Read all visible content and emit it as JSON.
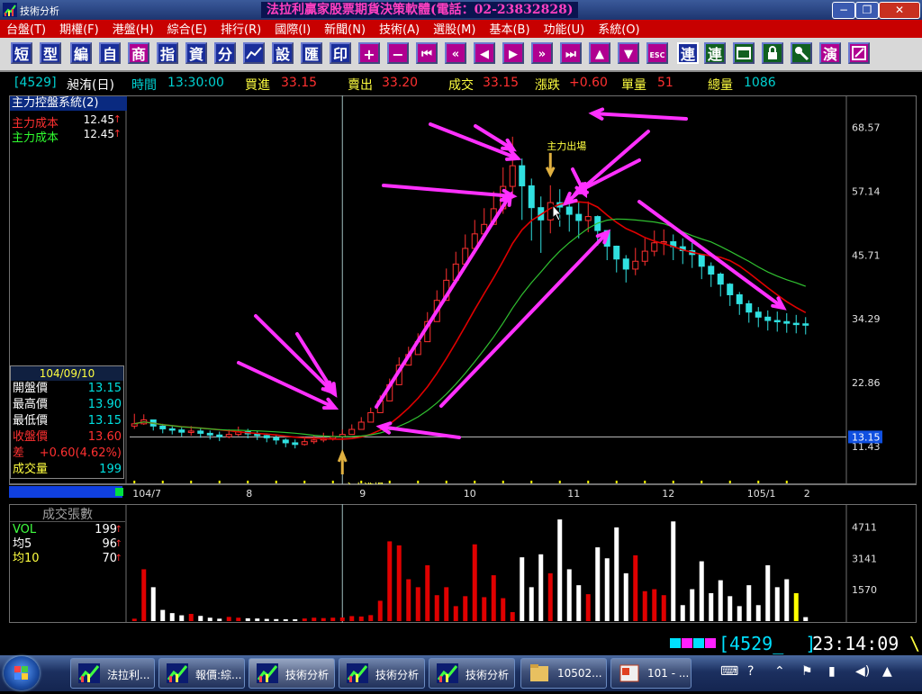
{
  "window": {
    "app_title": "技術分析",
    "headline": "法拉利贏家股票期貨決策軟體(電話：02-23832828)",
    "minimize_label": "−",
    "restore_label": "❐",
    "close_label": "✕"
  },
  "menu": [
    "台盤(T)",
    "期權(F)",
    "港盤(H)",
    "綜合(E)",
    "排行(R)",
    "國際(I)",
    "新聞(N)",
    "技術(A)",
    "選股(M)",
    "基本(B)",
    "功能(U)",
    "系統(O)"
  ],
  "toolbar": {
    "text_buttons": [
      "短",
      "型",
      "編",
      "自",
      "商",
      "指",
      "資",
      "分"
    ],
    "chart_icon": "chart-icon",
    "text_buttons2": [
      "設",
      "匯",
      "印"
    ],
    "plus": "+",
    "minus": "−",
    "nav_icons": [
      "rewind-bar-icon",
      "fast-rewind-icon",
      "prev-icon",
      "next-icon",
      "fast-forward-icon",
      "forward-bar-icon",
      "up-icon",
      "down-icon"
    ],
    "esc_label": "ESC",
    "lian1": "連",
    "lian2": "連",
    "tail_icons": [
      "window-icon",
      "lock-icon",
      "tools-icon",
      "演"
    ],
    "edit_icon": "edit-icon"
  },
  "quote": {
    "symbol": "[4529]",
    "name": "昶洧(日)",
    "time_label": "時間",
    "time": "13:30:00",
    "bid_label": "買進",
    "bid": "33.15",
    "ask_label": "賣出",
    "ask": "33.20",
    "last_label": "成交",
    "last": "33.15",
    "chg_label": "漲跌",
    "chg": "+0.60",
    "tick_vol_label": "單量",
    "tick_vol": "51",
    "total_vol_label": "總量",
    "total_vol": "1086"
  },
  "system_panel": {
    "title": "主力控盤系統(2)",
    "rows": [
      {
        "label": "主力成本",
        "value": "12.45",
        "mark": "↑",
        "color": "#ff3030"
      },
      {
        "label": "主力成本",
        "value": "12.45",
        "mark": "↑",
        "color": "#30ff30"
      }
    ]
  },
  "day_info": {
    "date": "104/09/10",
    "rows": [
      {
        "label": "開盤價",
        "value": "13.15",
        "color": "#ffffff",
        "vcolor": "#00e0e0"
      },
      {
        "label": "最高價",
        "value": "13.90",
        "color": "#ffffff",
        "vcolor": "#00e0e0"
      },
      {
        "label": "最低價",
        "value": "13.15",
        "color": "#ffffff",
        "vcolor": "#00e0e0"
      },
      {
        "label": "收盤價",
        "value": "13.60",
        "color": "#ff3030",
        "vcolor": "#ff3030"
      },
      {
        "label": "差",
        "value": "+0.60(4.62%)",
        "color": "#ff3030",
        "vcolor": "#ff3030"
      },
      {
        "label": "成交量",
        "value": "199",
        "color": "#ffff40",
        "vcolor": "#00e0e0"
      }
    ]
  },
  "annotations": {
    "entry": "主力進場",
    "exit": "主力出場",
    "current_price_tag": "13.15"
  },
  "volume_panel": {
    "title": "成交張數",
    "rows": [
      {
        "label": "VOL",
        "value": "199",
        "color": "#40ff40"
      },
      {
        "label": "均5",
        "value": "96",
        "color": "#ffffff"
      },
      {
        "label": "均10",
        "value": "70",
        "color": "#ffff40"
      }
    ]
  },
  "status": {
    "input": "[4529_  ]",
    "clock": "23:14:09"
  },
  "taskbar": {
    "tasks": [
      "法拉利...",
      "報價:綜...",
      "技術分析",
      "技術分析",
      "技術分析",
      "10502...",
      "101 - ..."
    ],
    "tray_icons": [
      "keyboard-icon",
      "help-icon",
      "expand-icon",
      "flag-icon",
      "network-icon",
      "volume-icon",
      "notification-icon"
    ]
  },
  "colors": {
    "up": "#ff3030",
    "down": "#30e0e0",
    "ma_short": "#e00000",
    "ma_long": "#30c030",
    "volume_up": "#e00000",
    "volume_down": "#ffffff",
    "volume_flat": "#ffff00",
    "overlay_arrows": "#ff30ff"
  },
  "chart_data": [
    {
      "type": "candlestick",
      "title": "[4529] 昶洧(日)",
      "y_ticks": [
        68.57,
        57.14,
        45.71,
        34.29,
        22.86,
        11.43
      ],
      "ylim": [
        5,
        73
      ],
      "x_ticks": [
        "104/7",
        "8",
        "9",
        "10",
        "11",
        "12",
        "105/1",
        "2"
      ],
      "closes": [
        15.5,
        16.2,
        15.1,
        14.6,
        14.4,
        14.0,
        14.2,
        13.8,
        13.5,
        13.2,
        13.6,
        14.1,
        13.7,
        13.4,
        13.0,
        12.6,
        12.1,
        11.8,
        12.3,
        12.6,
        12.9,
        13.2,
        13.6,
        14.5,
        15.8,
        17.5,
        19.6,
        22.5,
        26.0,
        27.9,
        30.2,
        33.8,
        37.6,
        41.2,
        44.1,
        46.9,
        49.5,
        51.2,
        54.0,
        58.0,
        61.7,
        58.1,
        54.2,
        52.0,
        55.1,
        54.3,
        53.0,
        51.9,
        52.6,
        50.1,
        47.3,
        45.0,
        43.2,
        44.6,
        46.4,
        47.9,
        48.1,
        47.2,
        46.5,
        45.8,
        43.7,
        42.3,
        40.5,
        38.6,
        37.0,
        35.5,
        34.6,
        34.0,
        33.8,
        33.5,
        33.4,
        33.15
      ],
      "highs": [
        17.3,
        17.2,
        16.2,
        15.5,
        15.2,
        14.9,
        15.1,
        14.7,
        14.3,
        14.1,
        14.5,
        15.0,
        14.6,
        14.2,
        13.8,
        13.4,
        12.9,
        12.7,
        13.2,
        13.5,
        13.9,
        14.1,
        14.5,
        15.4,
        16.7,
        18.4,
        20.6,
        23.6,
        27.4,
        29.3,
        31.7,
        35.5,
        39.4,
        43.3,
        46.3,
        49.4,
        52.0,
        54.1,
        57.1,
        61.4,
        66.9,
        63.0,
        59.4,
        56.2,
        58.2,
        57.5,
        56.4,
        55.2,
        55.3,
        52.8,
        49.8,
        47.4,
        45.7,
        47.0,
        48.7,
        50.1,
        50.3,
        49.4,
        48.7,
        47.9,
        45.8,
        44.4,
        42.6,
        40.7,
        39.1,
        37.6,
        36.4,
        35.8,
        35.6,
        35.3,
        35.0,
        34.6
      ],
      "lows": [
        14.6,
        15.3,
        14.3,
        13.8,
        13.6,
        13.2,
        13.4,
        13.0,
        12.7,
        12.4,
        12.9,
        13.3,
        12.9,
        12.6,
        12.2,
        11.8,
        11.3,
        11.1,
        11.6,
        11.9,
        12.2,
        12.5,
        12.9,
        13.7,
        14.9,
        16.5,
        18.5,
        21.2,
        24.6,
        26.4,
        28.6,
        32.0,
        35.6,
        39.0,
        41.8,
        44.4,
        47.0,
        48.6,
        51.3,
        53.1,
        55.8,
        52.0,
        48.3,
        46.1,
        49.6,
        50.8,
        49.9,
        48.7,
        49.8,
        47.4,
        44.8,
        42.6,
        40.8,
        42.1,
        43.8,
        45.5,
        45.7,
        44.8,
        44.1,
        43.4,
        41.4,
        40.0,
        38.3,
        36.6,
        35.0,
        33.6,
        32.8,
        32.2,
        32.0,
        31.8,
        31.7,
        31.5
      ],
      "cursor_index": 22
    },
    {
      "type": "bar",
      "title": "成交張數",
      "y_ticks": [
        4711,
        3141,
        1570
      ],
      "ylim": [
        0,
        5600
      ],
      "values": [
        120,
        2600,
        1700,
        560,
        400,
        290,
        360,
        260,
        170,
        120,
        210,
        170,
        140,
        130,
        110,
        100,
        90,
        90,
        130,
        170,
        150,
        170,
        180,
        250,
        230,
        300,
        1020,
        4000,
        3800,
        2100,
        1700,
        2800,
        1300,
        1700,
        750,
        1250,
        3850,
        1200,
        2300,
        1150,
        450,
        3200,
        1700,
        3350,
        2400,
        5100,
        2600,
        1800,
        1350,
        3700,
        3150,
        4700,
        2400,
        3300,
        1500,
        1600,
        1300,
        5000,
        800,
        1600,
        3000,
        1400,
        2050,
        1250,
        750,
        1800,
        800,
        2800,
        1700,
        2100,
        1400,
        199
      ]
    }
  ]
}
